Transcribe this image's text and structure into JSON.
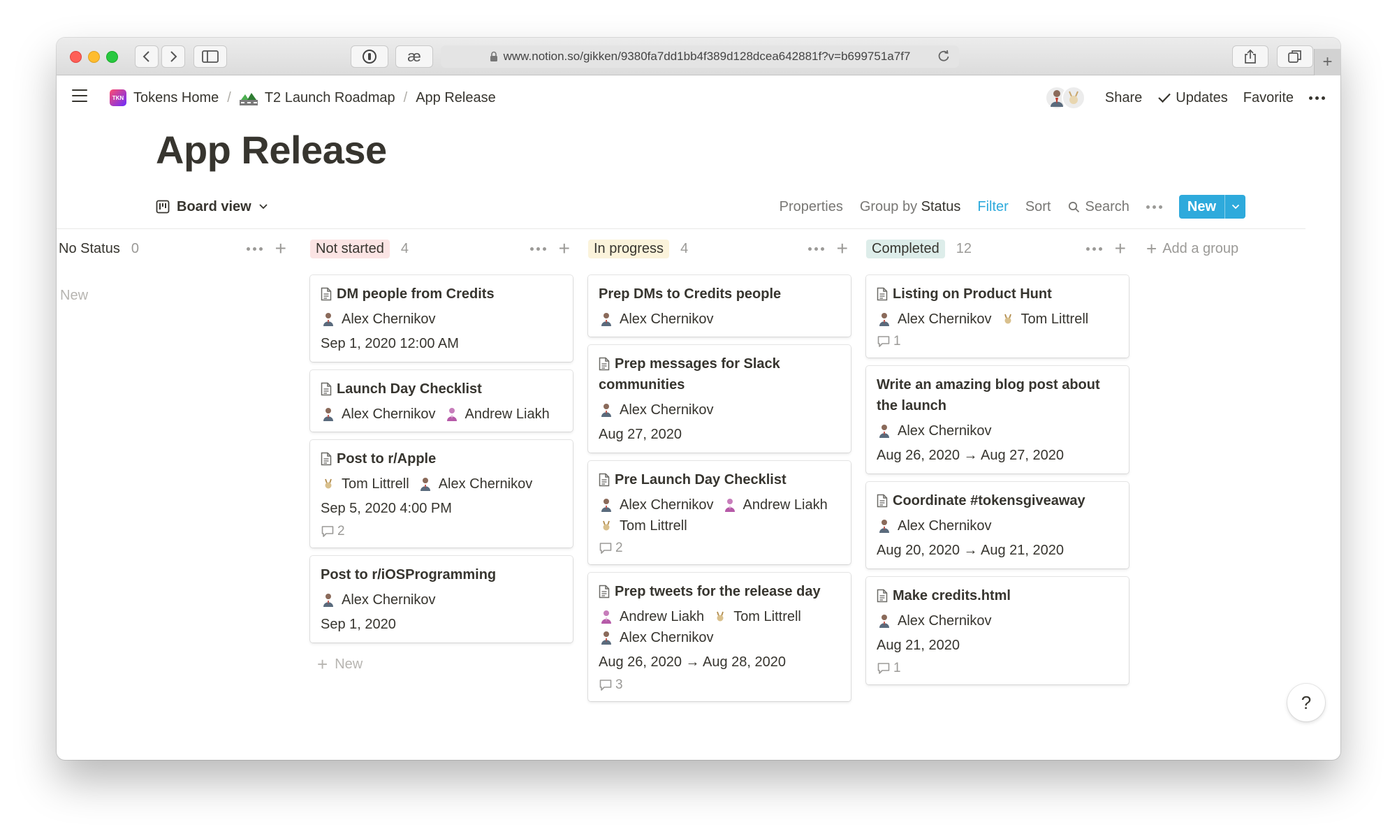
{
  "browser": {
    "url": "www.notion.so/gikken/9380fa7dd1bb4f389d128dcea642881f?v=b699751a7f7"
  },
  "breadcrumb": [
    {
      "label": "Tokens Home",
      "icon": "app-logo-icon",
      "icon_text": "TKN"
    },
    {
      "label": "T2 Launch Roadmap",
      "icon": "road-icon"
    },
    {
      "label": "App Release"
    }
  ],
  "topbar": {
    "share": "Share",
    "updates": "Updates",
    "favorite": "Favorite"
  },
  "page": {
    "title": "App Release"
  },
  "view": {
    "name": "Board view",
    "properties": "Properties",
    "group_by_label": "Group by",
    "group_by_value": "Status",
    "filter": "Filter",
    "sort": "Sort",
    "search": "Search",
    "new": "New"
  },
  "colors": {
    "accent": "#2eaadc",
    "not_started_bg": "#fbe4e4",
    "in_progress_bg": "#fbf3db",
    "completed_bg": "#ddedea"
  },
  "board": {
    "add_group": "Add a group",
    "new_label": "New",
    "columns": [
      {
        "name": "No Status",
        "count": "0",
        "cards": []
      },
      {
        "name": "Not started",
        "count": "4",
        "cards": [
          {
            "title": "DM people from Credits",
            "people": [
              "Alex Chernikov"
            ],
            "date": "Sep 1, 2020 12:00 AM",
            "comments": ""
          },
          {
            "title": "Launch Day Checklist",
            "people": [
              "Alex Chernikov",
              "Andrew Liakh"
            ],
            "date": "",
            "comments": ""
          },
          {
            "title": "Post to r/Apple",
            "people": [
              "Tom Littrell",
              "Alex Chernikov"
            ],
            "date": "Sep 5, 2020 4:00 PM",
            "comments": "2"
          },
          {
            "title": "Post to r/iOSProgramming",
            "people": [
              "Alex Chernikov"
            ],
            "date": "Sep 1, 2020",
            "comments": ""
          }
        ]
      },
      {
        "name": "In progress",
        "count": "4",
        "cards": [
          {
            "title": "Prep DMs to Credits people",
            "people": [
              "Alex Chernikov"
            ],
            "date": "",
            "comments": ""
          },
          {
            "title": "Prep messages for Slack communities",
            "people": [
              "Alex Chernikov"
            ],
            "date": "Aug 27, 2020",
            "comments": ""
          },
          {
            "title": "Pre Launch Day Checklist",
            "people": [
              "Alex Chernikov",
              "Andrew Liakh",
              "Tom Littrell"
            ],
            "date": "",
            "comments": "2"
          },
          {
            "title": "Prep tweets for the release day",
            "people": [
              "Andrew Liakh",
              "Tom Littrell",
              "Alex Chernikov"
            ],
            "date": "Aug 26, 2020 → Aug 28, 2020",
            "comments": "3"
          }
        ]
      },
      {
        "name": "Completed",
        "count": "12",
        "cards": [
          {
            "title": "Listing on Product Hunt",
            "people": [
              "Alex Chernikov",
              "Tom Littrell"
            ],
            "date": "",
            "comments": "1"
          },
          {
            "title": "Write an amazing blog post about the launch",
            "people": [
              "Alex Chernikov"
            ],
            "date": "Aug 26, 2020 → Aug 27, 2020",
            "comments": ""
          },
          {
            "title": "Coordinate #tokensgiveaway",
            "people": [
              "Alex Chernikov"
            ],
            "date": "Aug 20, 2020 → Aug 21, 2020",
            "comments": ""
          },
          {
            "title": "Make credits.html",
            "people": [
              "Alex Chernikov"
            ],
            "date": "Aug 21, 2020",
            "comments": "1"
          }
        ]
      }
    ]
  },
  "help": "?"
}
